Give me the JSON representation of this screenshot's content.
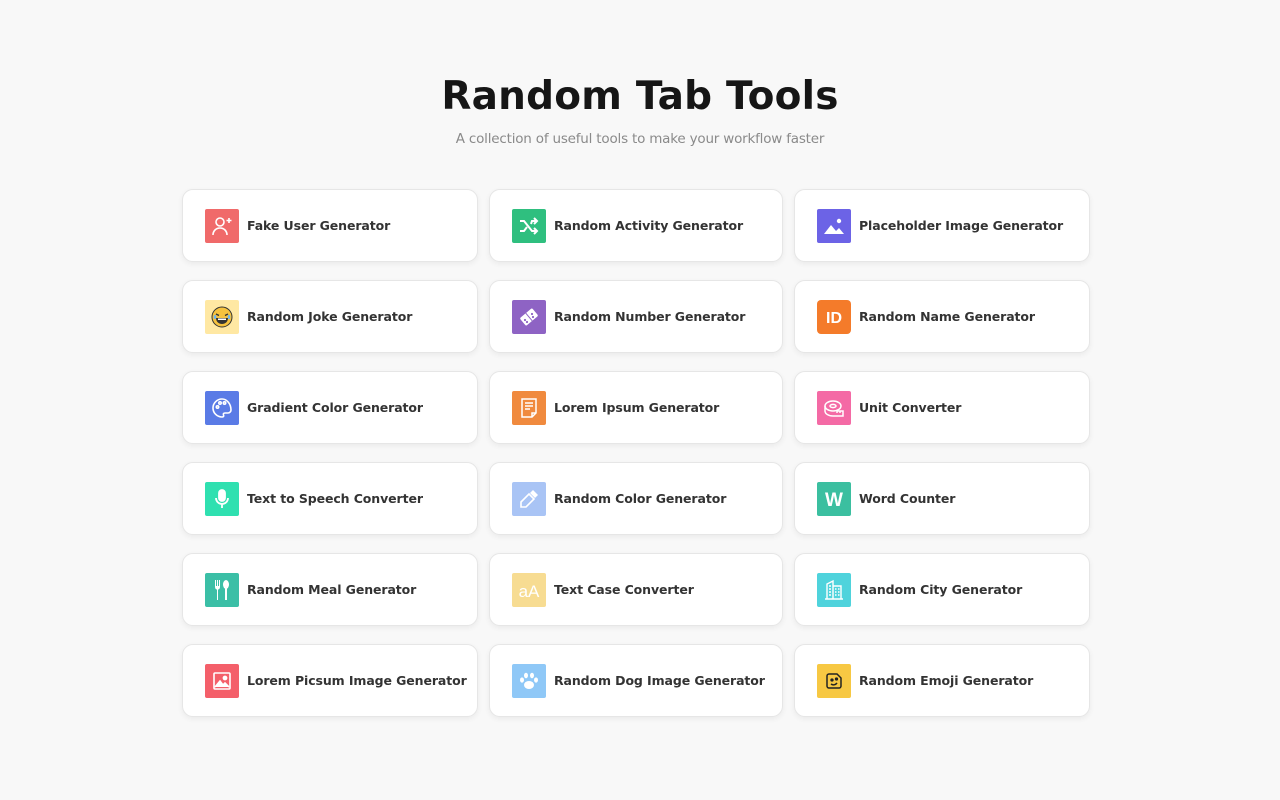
{
  "header": {
    "title": "Random Tab Tools",
    "subtitle": "A collection of useful tools to make your workflow faster"
  },
  "tools": [
    {
      "label": "Fake User Generator",
      "icon": "add-user-icon",
      "color": "#f06a6a"
    },
    {
      "label": "Random Activity Generator",
      "icon": "shuffle-icon",
      "color": "#2fbf7f"
    },
    {
      "label": "Placeholder Image Generator",
      "icon": "image-icon",
      "color": "#6c63e6"
    },
    {
      "label": "Random Joke Generator",
      "icon": "laughing-emoji-icon",
      "color": "#ffe8a3"
    },
    {
      "label": "Random Number Generator",
      "icon": "dice-icon",
      "color": "#8e63c4"
    },
    {
      "label": "Random Name Generator",
      "icon": "id-icon",
      "color": "#f47b2a"
    },
    {
      "label": "Gradient Color Generator",
      "icon": "palette-icon",
      "color": "#5a7be6"
    },
    {
      "label": "Lorem Ipsum Generator",
      "icon": "document-icon",
      "color": "#f08a3e"
    },
    {
      "label": "Unit Converter",
      "icon": "tape-measure-icon",
      "color": "#f46aa5"
    },
    {
      "label": "Text to Speech Converter",
      "icon": "microphone-icon",
      "color": "#2fe0b0"
    },
    {
      "label": "Random Color Generator",
      "icon": "eyedropper-icon",
      "color": "#a9c4f5"
    },
    {
      "label": "Word Counter",
      "icon": "letter-w-icon",
      "color": "#3bbfa0"
    },
    {
      "label": "Random Meal Generator",
      "icon": "fork-spoon-icon",
      "color": "#3bbfa6"
    },
    {
      "label": "Text Case Converter",
      "icon": "text-case-icon",
      "color": "#f7dc92"
    },
    {
      "label": "Random City Generator",
      "icon": "building-icon",
      "color": "#4fd3dc"
    },
    {
      "label": "Lorem Picsum Image Generator",
      "icon": "picture-icon",
      "color": "#f45f6a"
    },
    {
      "label": "Random Dog Image Generator",
      "icon": "paw-icon",
      "color": "#8fc8f7"
    },
    {
      "label": "Random Emoji Generator",
      "icon": "emoji-icon",
      "color": "#f7c843"
    }
  ]
}
